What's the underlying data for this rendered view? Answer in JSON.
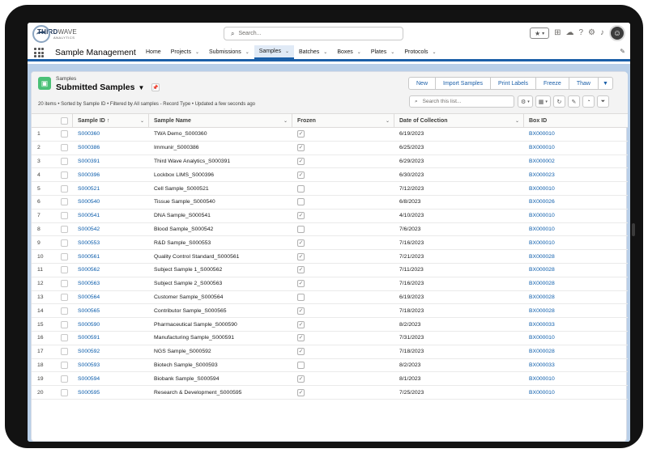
{
  "header": {
    "logo_primary": "THIRD",
    "logo_secondary": "WAVE",
    "logo_sub": "ANALYTICS",
    "search_placeholder": "Search..."
  },
  "app": {
    "name": "Sample Management",
    "nav": [
      {
        "label": "Home",
        "dropdown": false
      },
      {
        "label": "Projects",
        "dropdown": true
      },
      {
        "label": "Submissions",
        "dropdown": true
      },
      {
        "label": "Samples",
        "dropdown": true,
        "active": true
      },
      {
        "label": "Batches",
        "dropdown": true
      },
      {
        "label": "Boxes",
        "dropdown": true
      },
      {
        "label": "Plates",
        "dropdown": true
      },
      {
        "label": "Protocols",
        "dropdown": true
      }
    ]
  },
  "list": {
    "object_label": "Samples",
    "title": "Submitted Samples",
    "meta": "20 items • Sorted by Sample ID • Filtered by All samples - Record Type • Updated a few seconds ago",
    "buttons": [
      "New",
      "Import Samples",
      "Print Labels",
      "Freeze",
      "Thaw"
    ],
    "search_placeholder": "Search this list...",
    "columns": {
      "sample_id": "Sample ID",
      "sample_id_sort": "↑",
      "sample_name": "Sample Name",
      "frozen": "Frozen",
      "date": "Date of Collection",
      "box": "Box ID"
    },
    "rows": [
      {
        "n": "1",
        "id": "S000360",
        "name": "TWA Demo_S000360",
        "frozen": true,
        "date": "6/19/2023",
        "box": "BX000010"
      },
      {
        "n": "2",
        "id": "S000386",
        "name": "Immunir_S000386",
        "frozen": true,
        "date": "6/25/2023",
        "box": "BX000010"
      },
      {
        "n": "3",
        "id": "S000391",
        "name": "Third Wave Analytics_S000391",
        "frozen": true,
        "date": "6/29/2023",
        "box": "BX000002"
      },
      {
        "n": "4",
        "id": "S000396",
        "name": "Lockbox LIMS_S000396",
        "frozen": true,
        "date": "6/30/2023",
        "box": "BX000023"
      },
      {
        "n": "5",
        "id": "S000521",
        "name": "Cell Sample_S000521",
        "frozen": false,
        "date": "7/12/2023",
        "box": "BX000010"
      },
      {
        "n": "6",
        "id": "S000540",
        "name": "Tissue Sample_S000540",
        "frozen": false,
        "date": "6/8/2023",
        "box": "BX000026"
      },
      {
        "n": "7",
        "id": "S000541",
        "name": "DNA Sample_S000541",
        "frozen": true,
        "date": "4/10/2023",
        "box": "BX000010"
      },
      {
        "n": "8",
        "id": "S000542",
        "name": "Blood Sample_S000542",
        "frozen": false,
        "date": "7/6/2023",
        "box": "BX000010"
      },
      {
        "n": "9",
        "id": "S000553",
        "name": "R&D Sample_S000553",
        "frozen": true,
        "date": "7/16/2023",
        "box": "BX000010"
      },
      {
        "n": "10",
        "id": "S000561",
        "name": "Quality Control Standard_S000561",
        "frozen": true,
        "date": "7/21/2023",
        "box": "BX000028"
      },
      {
        "n": "11",
        "id": "S000562",
        "name": "Subject Sample 1_S000562",
        "frozen": true,
        "date": "7/11/2023",
        "box": "BX000028"
      },
      {
        "n": "12",
        "id": "S000563",
        "name": "Subject Sample 2_S000563",
        "frozen": true,
        "date": "7/16/2023",
        "box": "BX000028"
      },
      {
        "n": "13",
        "id": "S000564",
        "name": "Customer Sample_S000564",
        "frozen": false,
        "date": "6/19/2023",
        "box": "BX000028"
      },
      {
        "n": "14",
        "id": "S000565",
        "name": "Contributor Sample_S000565",
        "frozen": true,
        "date": "7/18/2023",
        "box": "BX000028"
      },
      {
        "n": "15",
        "id": "S000590",
        "name": "Pharmaceutical Sample_S000590",
        "frozen": true,
        "date": "8/2/2023",
        "box": "BX000033"
      },
      {
        "n": "16",
        "id": "S000591",
        "name": "Manufacturing Sample_S000591",
        "frozen": true,
        "date": "7/31/2023",
        "box": "BX000010"
      },
      {
        "n": "17",
        "id": "S000592",
        "name": "NGS Sample_S000592",
        "frozen": true,
        "date": "7/18/2023",
        "box": "BX000028"
      },
      {
        "n": "18",
        "id": "S000593",
        "name": "Biotech Sample_S000593",
        "frozen": false,
        "date": "8/2/2023",
        "box": "BX000033"
      },
      {
        "n": "19",
        "id": "S000594",
        "name": "Biobank Sample_S000594",
        "frozen": true,
        "date": "8/1/2023",
        "box": "BX000010"
      },
      {
        "n": "20",
        "id": "S000595",
        "name": "Research & Development_S000595",
        "frozen": true,
        "date": "7/25/2023",
        "box": "BX000010"
      }
    ]
  },
  "colors": {
    "accent": "#1b5fa8",
    "link": "#0b5cab",
    "object_icon": "#4bc076",
    "page_bg": "#b9cfe8"
  }
}
